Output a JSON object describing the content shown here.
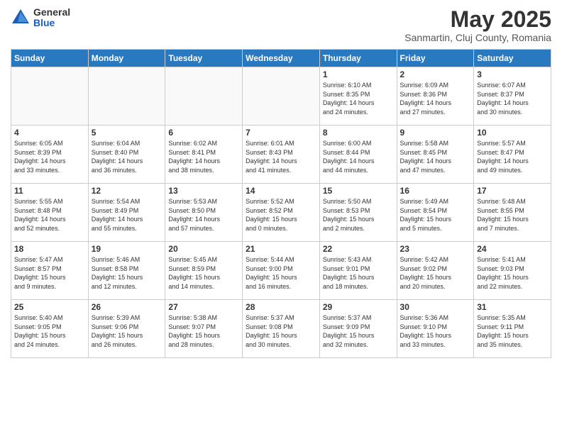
{
  "header": {
    "logo_general": "General",
    "logo_blue": "Blue",
    "main_title": "May 2025",
    "subtitle": "Sanmartin, Cluj County, Romania"
  },
  "weekdays": [
    "Sunday",
    "Monday",
    "Tuesday",
    "Wednesday",
    "Thursday",
    "Friday",
    "Saturday"
  ],
  "weeks": [
    [
      {
        "day": "",
        "info": ""
      },
      {
        "day": "",
        "info": ""
      },
      {
        "day": "",
        "info": ""
      },
      {
        "day": "",
        "info": ""
      },
      {
        "day": "1",
        "info": "Sunrise: 6:10 AM\nSunset: 8:35 PM\nDaylight: 14 hours\nand 24 minutes."
      },
      {
        "day": "2",
        "info": "Sunrise: 6:09 AM\nSunset: 8:36 PM\nDaylight: 14 hours\nand 27 minutes."
      },
      {
        "day": "3",
        "info": "Sunrise: 6:07 AM\nSunset: 8:37 PM\nDaylight: 14 hours\nand 30 minutes."
      }
    ],
    [
      {
        "day": "4",
        "info": "Sunrise: 6:05 AM\nSunset: 8:39 PM\nDaylight: 14 hours\nand 33 minutes."
      },
      {
        "day": "5",
        "info": "Sunrise: 6:04 AM\nSunset: 8:40 PM\nDaylight: 14 hours\nand 36 minutes."
      },
      {
        "day": "6",
        "info": "Sunrise: 6:02 AM\nSunset: 8:41 PM\nDaylight: 14 hours\nand 38 minutes."
      },
      {
        "day": "7",
        "info": "Sunrise: 6:01 AM\nSunset: 8:43 PM\nDaylight: 14 hours\nand 41 minutes."
      },
      {
        "day": "8",
        "info": "Sunrise: 6:00 AM\nSunset: 8:44 PM\nDaylight: 14 hours\nand 44 minutes."
      },
      {
        "day": "9",
        "info": "Sunrise: 5:58 AM\nSunset: 8:45 PM\nDaylight: 14 hours\nand 47 minutes."
      },
      {
        "day": "10",
        "info": "Sunrise: 5:57 AM\nSunset: 8:47 PM\nDaylight: 14 hours\nand 49 minutes."
      }
    ],
    [
      {
        "day": "11",
        "info": "Sunrise: 5:55 AM\nSunset: 8:48 PM\nDaylight: 14 hours\nand 52 minutes."
      },
      {
        "day": "12",
        "info": "Sunrise: 5:54 AM\nSunset: 8:49 PM\nDaylight: 14 hours\nand 55 minutes."
      },
      {
        "day": "13",
        "info": "Sunrise: 5:53 AM\nSunset: 8:50 PM\nDaylight: 14 hours\nand 57 minutes."
      },
      {
        "day": "14",
        "info": "Sunrise: 5:52 AM\nSunset: 8:52 PM\nDaylight: 15 hours\nand 0 minutes."
      },
      {
        "day": "15",
        "info": "Sunrise: 5:50 AM\nSunset: 8:53 PM\nDaylight: 15 hours\nand 2 minutes."
      },
      {
        "day": "16",
        "info": "Sunrise: 5:49 AM\nSunset: 8:54 PM\nDaylight: 15 hours\nand 5 minutes."
      },
      {
        "day": "17",
        "info": "Sunrise: 5:48 AM\nSunset: 8:55 PM\nDaylight: 15 hours\nand 7 minutes."
      }
    ],
    [
      {
        "day": "18",
        "info": "Sunrise: 5:47 AM\nSunset: 8:57 PM\nDaylight: 15 hours\nand 9 minutes."
      },
      {
        "day": "19",
        "info": "Sunrise: 5:46 AM\nSunset: 8:58 PM\nDaylight: 15 hours\nand 12 minutes."
      },
      {
        "day": "20",
        "info": "Sunrise: 5:45 AM\nSunset: 8:59 PM\nDaylight: 15 hours\nand 14 minutes."
      },
      {
        "day": "21",
        "info": "Sunrise: 5:44 AM\nSunset: 9:00 PM\nDaylight: 15 hours\nand 16 minutes."
      },
      {
        "day": "22",
        "info": "Sunrise: 5:43 AM\nSunset: 9:01 PM\nDaylight: 15 hours\nand 18 minutes."
      },
      {
        "day": "23",
        "info": "Sunrise: 5:42 AM\nSunset: 9:02 PM\nDaylight: 15 hours\nand 20 minutes."
      },
      {
        "day": "24",
        "info": "Sunrise: 5:41 AM\nSunset: 9:03 PM\nDaylight: 15 hours\nand 22 minutes."
      }
    ],
    [
      {
        "day": "25",
        "info": "Sunrise: 5:40 AM\nSunset: 9:05 PM\nDaylight: 15 hours\nand 24 minutes."
      },
      {
        "day": "26",
        "info": "Sunrise: 5:39 AM\nSunset: 9:06 PM\nDaylight: 15 hours\nand 26 minutes."
      },
      {
        "day": "27",
        "info": "Sunrise: 5:38 AM\nSunset: 9:07 PM\nDaylight: 15 hours\nand 28 minutes."
      },
      {
        "day": "28",
        "info": "Sunrise: 5:37 AM\nSunset: 9:08 PM\nDaylight: 15 hours\nand 30 minutes."
      },
      {
        "day": "29",
        "info": "Sunrise: 5:37 AM\nSunset: 9:09 PM\nDaylight: 15 hours\nand 32 minutes."
      },
      {
        "day": "30",
        "info": "Sunrise: 5:36 AM\nSunset: 9:10 PM\nDaylight: 15 hours\nand 33 minutes."
      },
      {
        "day": "31",
        "info": "Sunrise: 5:35 AM\nSunset: 9:11 PM\nDaylight: 15 hours\nand 35 minutes."
      }
    ]
  ]
}
